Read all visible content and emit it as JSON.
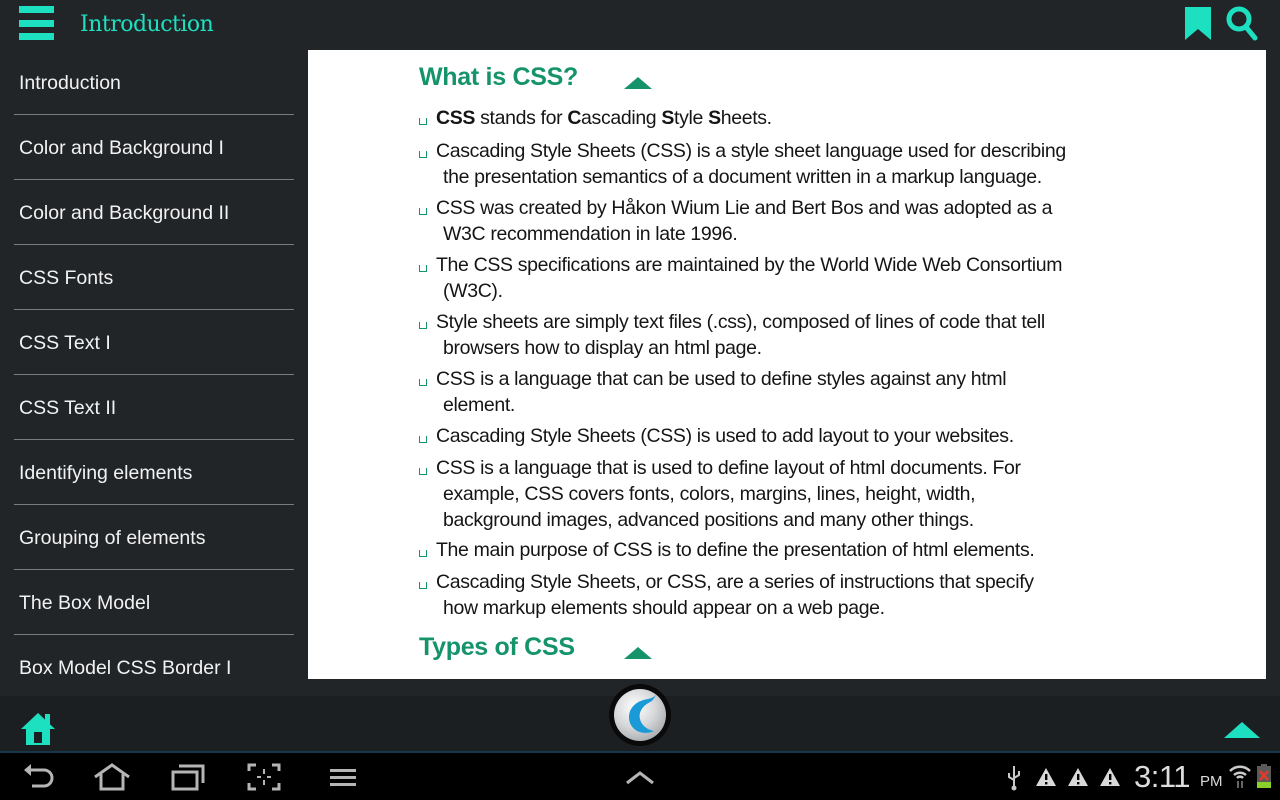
{
  "header": {
    "title": "Introduction",
    "menu_icon": "hamburger-menu-icon",
    "bookmark_icon": "bookmark-icon",
    "search_icon": "search-icon",
    "accent_color": "#1de0c0"
  },
  "sidebar": {
    "items": [
      {
        "label": "Introduction"
      },
      {
        "label": "Color and Background I"
      },
      {
        "label": "Color and Background II"
      },
      {
        "label": "CSS Fonts"
      },
      {
        "label": "CSS Text I"
      },
      {
        "label": "CSS Text II"
      },
      {
        "label": "Identifying elements"
      },
      {
        "label": "Grouping of elements"
      },
      {
        "label": "The Box Model"
      },
      {
        "label": "Box Model CSS Border I"
      }
    ]
  },
  "content": {
    "heading_color": "#15936b",
    "sections": [
      {
        "title": "What is CSS?",
        "bullets": [
          {
            "lines": [
              "CSS stands for Cascading Style Sheets."
            ]
          },
          {
            "lines": [
              "Cascading Style Sheets (CSS) is a style sheet language used for describing",
              "the presentation semantics of a document written in a markup language."
            ]
          },
          {
            "lines": [
              "CSS was created by Håkon Wium Lie and Bert Bos and was adopted as a",
              "W3C recommendation in late 1996."
            ]
          },
          {
            "lines": [
              "The CSS specifications are maintained by the World Wide Web Consortium",
              "(W3C)."
            ]
          },
          {
            "lines": [
              "Style sheets are simply text files (.css), composed of lines of code that tell",
              "browsers how to display an html page."
            ]
          },
          {
            "lines": [
              "CSS is a language that can be used to define styles against any html",
              "element."
            ]
          },
          {
            "lines": [
              "Cascading Style Sheets (CSS) is used to add layout to your websites."
            ]
          },
          {
            "lines": [
              "CSS is a language that is used to define layout of html documents. For",
              "example, CSS covers fonts, colors, margins, lines, height, width,",
              "background images, advanced positions and many other things."
            ]
          },
          {
            "lines": [
              "The main purpose of CSS is to define the presentation of html elements."
            ]
          },
          {
            "lines": [
              "Cascading Style Sheets, or CSS, are a series of instructions that specify",
              "how markup elements should appear on a web page."
            ]
          }
        ]
      },
      {
        "title": "Types of CSS",
        "bullets": []
      }
    ],
    "first_bullet_parts": [
      {
        "text": "CSS",
        "bold": true
      },
      {
        "text": " stands for ",
        "bold": false
      },
      {
        "text": "C",
        "bold": true
      },
      {
        "text": "ascading ",
        "bold": false
      },
      {
        "text": "S",
        "bold": true
      },
      {
        "text": "tyle ",
        "bold": false
      },
      {
        "text": "S",
        "bold": true
      },
      {
        "text": "heets.",
        "bold": false
      }
    ]
  },
  "bottom_bar": {
    "home_icon": "home-icon",
    "logo_icon": "app-logo-icon",
    "scroll_top_icon": "scroll-to-top-icon"
  },
  "system_bar": {
    "time": "3:11",
    "ampm": "PM",
    "nav": [
      "back-icon",
      "home-icon",
      "recent-apps-icon",
      "screenshot-icon",
      "menu-icon"
    ],
    "status_icons": [
      "usb-icon",
      "warning-icon",
      "warning-icon",
      "warning-icon",
      "wifi-icon",
      "battery-icon"
    ]
  }
}
